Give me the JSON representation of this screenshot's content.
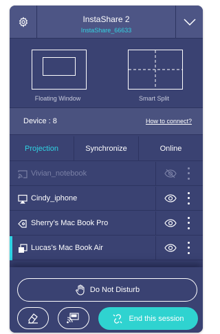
{
  "header": {
    "title": "InstaShare 2",
    "subtitle": "InstaShare_66633",
    "settings_icon": "gear-icon",
    "toggle_icon": "chevron-down-icon"
  },
  "modes": [
    {
      "label": "Floating Window",
      "icon": "floating-window-icon"
    },
    {
      "label": "Smart Split",
      "icon": "smart-split-icon"
    }
  ],
  "devices": {
    "count_label": "Device : 8",
    "help_link": "How to connect?"
  },
  "tabs": [
    {
      "label": "Projection",
      "active": true
    },
    {
      "label": "Synchronize",
      "active": false
    },
    {
      "label": "Online",
      "active": false
    }
  ],
  "device_list": [
    {
      "name": "Vivian_notebook",
      "icon": "cast-icon",
      "visibility": "hidden",
      "state": "disabled"
    },
    {
      "name": "Cindy_iphone",
      "icon": "airplay-icon",
      "visibility": "visible",
      "state": "normal"
    },
    {
      "name": "Sherry’s Mac Book Pro",
      "icon": "tag-icon",
      "visibility": "visible",
      "state": "normal"
    },
    {
      "name": "Lucas’s Mac Book Air",
      "icon": "screen-share-icon",
      "visibility": "visible",
      "state": "selected"
    }
  ],
  "actions": {
    "do_not_disturb": "Do Not Disturb",
    "end_session": "End this session"
  },
  "colors": {
    "panel": "#3a4272",
    "header": "#4d5585",
    "accent": "#2fd3e3",
    "end_button": "#2fd3d0",
    "border": "#2d3460"
  }
}
